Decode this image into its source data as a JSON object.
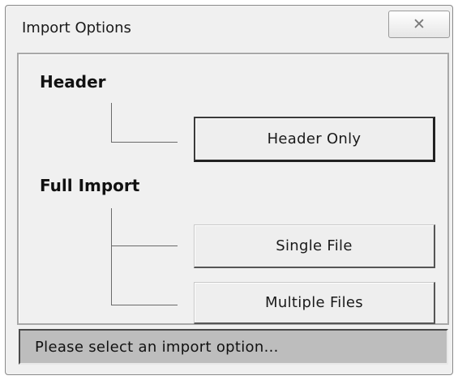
{
  "window": {
    "title": "Import Options",
    "close_glyph": "☒"
  },
  "sections": {
    "header": {
      "label": "Header",
      "buttons": {
        "header_only": "Header Only"
      }
    },
    "full_import": {
      "label": "Full Import",
      "buttons": {
        "single_file": "Single File",
        "multiple_files": "Multiple Files"
      }
    }
  },
  "status_bar": {
    "text": "Please select an import option..."
  },
  "icons": {
    "close": "close-icon"
  }
}
